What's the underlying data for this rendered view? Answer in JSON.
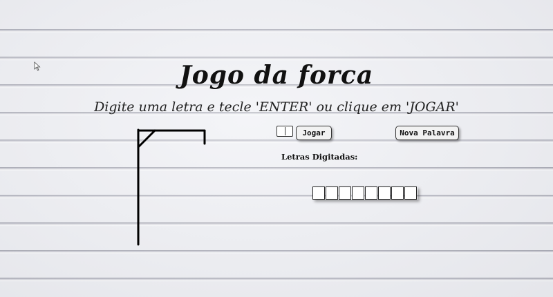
{
  "game": {
    "title": "Jogo da forca",
    "instructions": "Digite uma letra e tecle 'ENTER' ou clique em 'JOGAR'",
    "letter_input": {
      "value": ""
    },
    "play_button_label": "Jogar",
    "new_word_button_label": "Nova Palavra",
    "typed_letters_label": "Letras Digitadas:",
    "typed_letters": "",
    "word_slots": [
      "",
      "",
      "",
      "",
      "",
      "",
      "",
      ""
    ],
    "wrong_guesses": 0
  },
  "icons": {
    "cursor": "mouse-pointer-icon"
  },
  "colors": {
    "ink": "#111111",
    "background": "#eeeff4"
  }
}
